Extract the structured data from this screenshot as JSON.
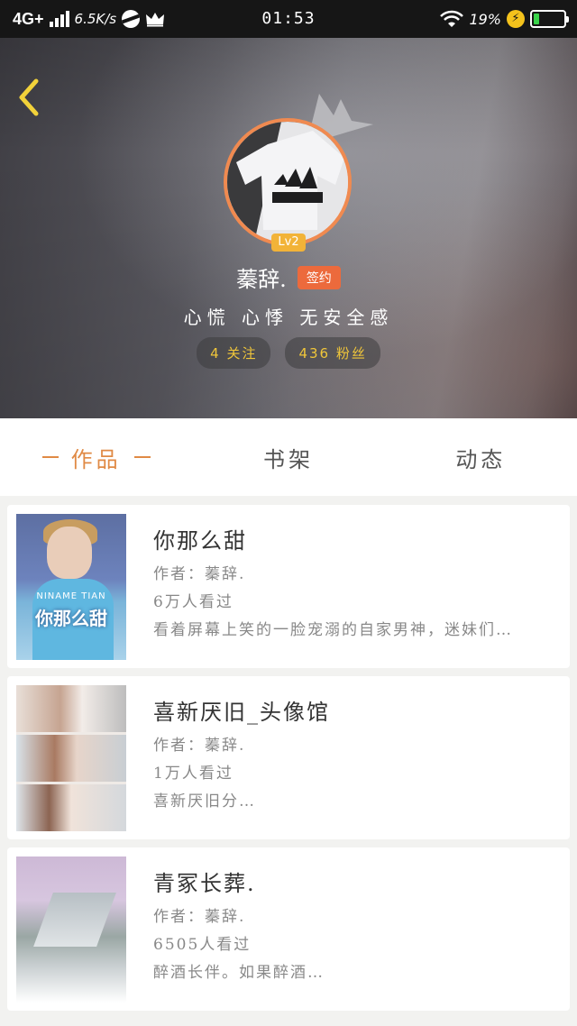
{
  "status_bar": {
    "network": "4G+",
    "speed": "6.5K/s",
    "time": "01:53",
    "battery": "19%",
    "battery_level": 0.19,
    "battery_color": "#3ad34a"
  },
  "profile": {
    "level": "Lv2",
    "username": "蓁辞.",
    "signed_label": "签约",
    "bio": "心慌 心悸 无安全感",
    "following": "4 关注",
    "followers": "436 粉丝",
    "accent_color": "#ec6a3c",
    "avatar_ring_color": "#f08a50"
  },
  "tabs": [
    {
      "label": "作品",
      "active": true
    },
    {
      "label": "书架",
      "active": false
    },
    {
      "label": "动态",
      "active": false
    }
  ],
  "works": [
    {
      "title": "你那么甜",
      "author": "作者：蓁辞.",
      "views": "6万人看过",
      "excerpt": "看着屏幕上笑的一脸宠溺的自家男神，迷妹们…",
      "cover_text": "你那么甜",
      "cover_sub": "NINAME TIAN"
    },
    {
      "title": "喜新厌旧_头像馆",
      "author": "作者：蓁辞.",
      "views": "1万人看过",
      "excerpt": "喜新厌旧分…"
    },
    {
      "title": "青冢长葬.",
      "author": "作者：蓁辞.",
      "views": "6505人看过",
      "excerpt": "醉酒长伴。如果醉酒…"
    }
  ]
}
